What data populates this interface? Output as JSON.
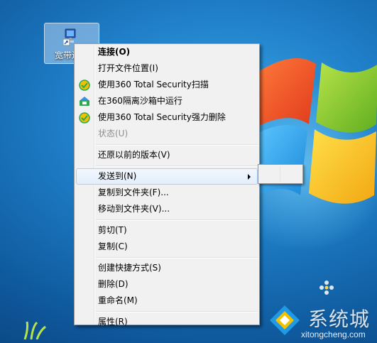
{
  "desktop": {
    "shortcut_label": "宽带连接"
  },
  "menu": {
    "items": [
      {
        "label": "连接(O)",
        "bold": true
      },
      {
        "label": "打开文件位置(I)"
      },
      {
        "label": "使用360 Total Security扫描",
        "icon": "360-shield-icon"
      },
      {
        "label": "在360隔离沙箱中运行",
        "icon": "sandbox-icon"
      },
      {
        "label": "使用360 Total Security强力删除",
        "icon": "360-shield-icon"
      },
      {
        "label": "状态(U)",
        "disabled": true
      },
      {
        "label": "还原以前的版本(V)"
      },
      {
        "label": "发送到(N)",
        "submenu": true,
        "hover": true
      },
      {
        "label": "复制到文件夹(F)..."
      },
      {
        "label": "移动到文件夹(V)..."
      },
      {
        "label": "剪切(T)"
      },
      {
        "label": "复制(C)"
      },
      {
        "label": "创建快捷方式(S)"
      },
      {
        "label": "删除(D)"
      },
      {
        "label": "重命名(M)"
      },
      {
        "label": "属性(R)"
      }
    ]
  },
  "watermark": {
    "cn": "系统城",
    "en": "xitongcheng.com"
  },
  "colors": {
    "menu_bg": "#f1f1f1",
    "hover_border": "#aecff7",
    "desktop_blue": "#1f7fc8",
    "shield_yellow": "#f2c200",
    "shield_green": "#2fa84f"
  }
}
